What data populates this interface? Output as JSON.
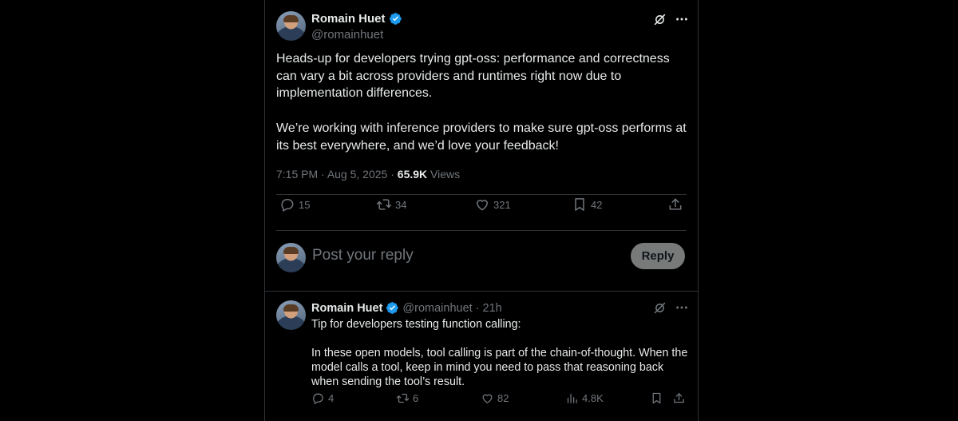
{
  "main_tweet": {
    "author_name": "Romain Huet",
    "author_handle": "@romainhuet",
    "paragraphs": [
      "Heads-up for developers trying gpt-oss: performance and correctness can vary a bit across providers and runtimes right now due to implementation differences.",
      "We’re working with inference providers to make sure gpt-oss performs at its best everywhere, and we’d love your feedback!"
    ],
    "time": "7:15 PM",
    "date": "Aug 5, 2025",
    "views_count": "65.9K",
    "views_label": "Views",
    "replies": "15",
    "reposts": "34",
    "likes": "321",
    "bookmarks": "42"
  },
  "reply_composer": {
    "placeholder": "Post your reply",
    "button_label": "Reply"
  },
  "reply_tweet": {
    "author_name": "Romain Huet",
    "author_handle": "@romainhuet",
    "age": "21h",
    "paragraphs": [
      "Tip for developers testing function calling:",
      "In these open models, tool calling is part of the chain-of-thought. When the model calls a tool, keep in mind you need to pass that reasoning back when sending the tool’s result."
    ],
    "replies": "4",
    "reposts": "6",
    "likes": "82",
    "views": "4.8K"
  },
  "colors": {
    "background": "#000000",
    "text": "#e7e9ea",
    "muted": "#71767b",
    "border": "#2f3336",
    "verified": "#1d9bf0"
  },
  "icons": [
    "verified-badge-icon",
    "grok-icon",
    "more-icon",
    "reply-icon",
    "repost-icon",
    "like-icon",
    "bookmark-icon",
    "share-icon",
    "views-icon"
  ]
}
